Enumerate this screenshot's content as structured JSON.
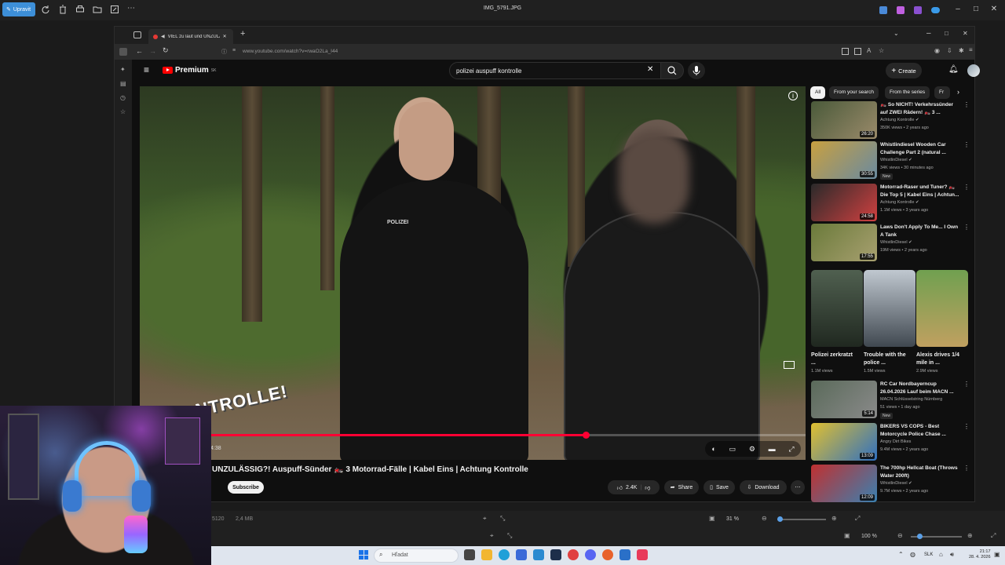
{
  "viewer": {
    "edit_label": "Upravit",
    "filename": "IMG_5791.JPG",
    "file_info": "5120",
    "file_size": "2,4 MB",
    "zoom_small": "31 %",
    "zoom_main": "100 %"
  },
  "browser": {
    "tab_title": "VIEL zu laut und UNZULÄ",
    "url": "www.youtube.com/watch?v=rwaO2La_I44"
  },
  "youtube": {
    "logo": "Premium",
    "logo_sup": "SK",
    "search_query": "polizei auspuff kontrolle",
    "create_label": "Create",
    "video_title": "UNZULÄSSIG?! Auspuff-Sünder 🏍️ 3 Motorrad-Fälle | Kabel Eins | Achtung Kontrolle",
    "subscribe_label": "Subscribe",
    "likes": "2.4K",
    "share_label": "Share",
    "save_label": "Save",
    "download_label": "Download",
    "time": "4:38",
    "progress": 0.67,
    "badge_text": "NTROLLE!",
    "chips": [
      "All",
      "From your search",
      "From the series",
      "Fr"
    ],
    "recommendations": [
      {
        "title": "🏍️ So NICHT! Verkehrssünder auf ZWEI Rädern! 🏍️ 3 ...",
        "channel": "Achtung Kontrolle ✔",
        "meta": "350K views • 2 years ago",
        "duration": "26:20",
        "new": "",
        "thumb_a": "#4a5a3a",
        "thumb_b": "#9a8a6a"
      },
      {
        "title": "Whistlindiesel Wooden Car Challenge Part 2 (natural ...",
        "channel": "WhistlinDiesel ✔",
        "meta": "34K views • 30 minutes ago",
        "duration": "30:55",
        "new": "New",
        "thumb_a": "#c8a040",
        "thumb_b": "#6a8aa0"
      },
      {
        "title": "Motorrad-Raser und Tuner? 🏍️ Die Top 5 | Kabel Eins | Achtun...",
        "channel": "Achtung Kontrolle ✔",
        "meta": "1.1M views • 3 years ago",
        "duration": "24:58",
        "new": "",
        "thumb_a": "#2a2a2a",
        "thumb_b": "#d04040"
      },
      {
        "title": "Laws Don't Apply To Me... I Own A Tank",
        "channel": "WhistlinDiesel ✔",
        "meta": "19M views • 2 years ago",
        "duration": "17:55",
        "new": "",
        "thumb_a": "#6a7a3a",
        "thumb_b": "#a8a070"
      },
      {
        "title": "RC Car Nordbayerncup 26.04.2026 Lauf beim MACN ...",
        "channel": "MACN Schlüsselstring Nürnberg",
        "meta": "51 views • 1 day ago",
        "duration": "5:14",
        "new": "New",
        "thumb_a": "#5a6a5a",
        "thumb_b": "#8a8a8a"
      },
      {
        "title": "BIKERS VS COPS - Best Motorcycle Police Chase ...",
        "channel": "Angry Dirt Bikes",
        "meta": "9.4M views • 2 years ago",
        "duration": "13:09",
        "new": "",
        "thumb_a": "#e0c030",
        "thumb_b": "#3070c0"
      },
      {
        "title": "The 700hp Hellcat Boat (Throws Water 200ft)",
        "channel": "WhistlinDiesel ✔",
        "meta": "9.7M views • 2 years ago",
        "duration": "12:09",
        "new": "",
        "thumb_a": "#c03030",
        "thumb_b": "#3a80b0"
      }
    ],
    "shorts": [
      {
        "title": "Polizei zerkratzt ...",
        "views": "1.1M views",
        "color_a": "#506050",
        "color_b": "#202820"
      },
      {
        "title": "Trouble with the police ...",
        "views": "1.5M views",
        "color_a": "#c0c8d0",
        "color_b": "#404850"
      },
      {
        "title": "Alexis drives 1/4 mile in ...",
        "views": "2.9M views",
        "color_a": "#70a050",
        "color_b": "#c0a060"
      }
    ]
  },
  "taskbar": {
    "search_placeholder": "Hľadat",
    "lang": "SLK",
    "time": "21:17",
    "date": "28. 4. 2026"
  },
  "colors": {
    "yt_red": "#ff0033",
    "accent": "#3d8fd8"
  }
}
